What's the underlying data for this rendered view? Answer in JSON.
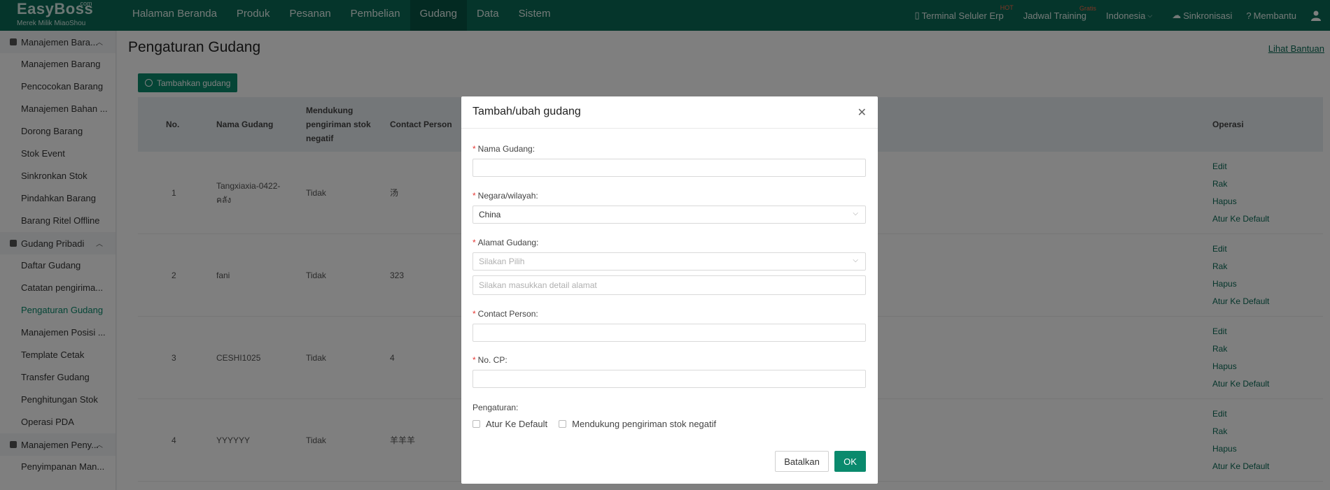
{
  "app": {
    "logo": "EasyBoss",
    "logo_com": ".com",
    "logo_sub": "Merek Milik MiaoShou"
  },
  "nav": [
    {
      "label": "Halaman Beranda"
    },
    {
      "label": "Produk"
    },
    {
      "label": "Pesanan"
    },
    {
      "label": "Pembelian"
    },
    {
      "label": "Gudang"
    },
    {
      "label": "Data"
    },
    {
      "label": "Sistem"
    }
  ],
  "topright": {
    "terminal": "Terminal Seluler Erp",
    "terminal_badge": "HOT",
    "training": "Jadwal Training",
    "training_badge": "Gratis",
    "language": "Indonesia",
    "sync": "Sinkronisasi",
    "help": "Membantu"
  },
  "sidebar": {
    "group1": "Manajemen Bara...",
    "group1_items": [
      "Manajemen Barang",
      "Pencocokan Barang",
      "Manajemen Bahan ...",
      "Dorong Barang",
      "Stok Event",
      "Sinkronkan Stok",
      "Pindahkan Barang",
      "Barang Ritel Offline"
    ],
    "group2": "Gudang Pribadi",
    "group2_items": [
      "Daftar Gudang",
      "Catatan pengirima...",
      "Pengaturan Gudang",
      "Manajemen Posisi ...",
      "Template Cetak",
      "Transfer Gudang",
      "Penghitungan Stok",
      "Operasi PDA"
    ],
    "group3": "Manajemen Peny...",
    "group3_items": [
      "Penyimpanan Man..."
    ]
  },
  "page": {
    "title": "Pengaturan Gudang",
    "help_link": "Lihat Bantuan",
    "add_button": "Tambahkan gudang"
  },
  "table": {
    "headers": {
      "no": "No.",
      "name": "Nama Gudang",
      "negative": "Mendukung pengiriman stok negatif",
      "contact": "Contact Person",
      "ops": "Operasi"
    },
    "rows": [
      {
        "no": "1",
        "name": "Tangxiaxia-0422-คลัง",
        "negative": "Tidak",
        "contact": "汤"
      },
      {
        "no": "2",
        "name": "fani",
        "negative": "Tidak",
        "contact": "323"
      },
      {
        "no": "3",
        "name": "CESHI1025",
        "negative": "Tidak",
        "contact": "4"
      },
      {
        "no": "4",
        "name": "YYYYYY",
        "negative": "Tidak",
        "contact": "羊羊羊"
      }
    ],
    "ops": {
      "edit": "Edit",
      "rack": "Rak",
      "delete": "Hapus",
      "default": "Atur Ke Default"
    }
  },
  "modal": {
    "title": "Tambah/ubah gudang",
    "name_label": "Nama Gudang:",
    "country_label": "Negara/wilayah:",
    "country_value": "China",
    "address_label": "Alamat Gudang:",
    "address_placeholder": "Silakan Pilih",
    "address_detail_placeholder": "Silakan masukkan detail alamat",
    "contact_label": "Contact Person:",
    "phone_label": "No. CP:",
    "settings_label": "Pengaturan:",
    "check_default": "Atur Ke Default",
    "check_negative": "Mendukung pengiriman stok negatif",
    "cancel": "Batalkan",
    "ok": "OK"
  }
}
